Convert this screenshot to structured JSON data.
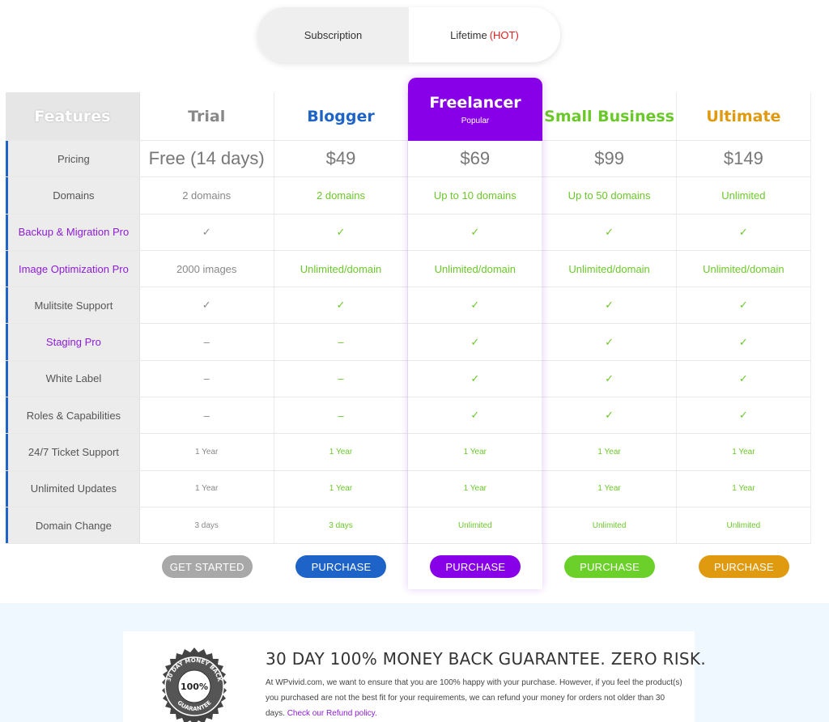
{
  "toggle": {
    "subscription_label": "Subscription",
    "lifetime_label": "Lifetime",
    "lifetime_hot": "(HOT)"
  },
  "table": {
    "features_header": "Features",
    "plans": [
      {
        "name": "Trial",
        "color": "#888888"
      },
      {
        "name": "Blogger",
        "color": "#1e64c8"
      },
      {
        "name": "Freelancer",
        "color": "#8800e8",
        "badge": "Popular"
      },
      {
        "name": "Small Business",
        "color": "#6bc82a"
      },
      {
        "name": "Ultimate",
        "color": "#e09a10"
      }
    ],
    "rows": [
      {
        "feature": "Pricing",
        "feature_color": "normal",
        "type": "price",
        "values": [
          "Free (14 days)",
          "$49",
          "$69",
          "$99",
          "$149"
        ]
      },
      {
        "feature": "Domains",
        "feature_color": "normal",
        "values": [
          "2 domains",
          "2 domains",
          "Up to 10 domains",
          "Up to 50 domains",
          "Unlimited"
        ]
      },
      {
        "feature": "Backup & Migration Pro",
        "feature_color": "purple",
        "values": [
          "✓",
          "✓",
          "✓",
          "✓",
          "✓"
        ]
      },
      {
        "feature": "Image Optimization Pro",
        "feature_color": "purple",
        "values": [
          "2000 images",
          "Unlimited/domain",
          "Unlimited/domain",
          "Unlimited/domain",
          "Unlimited/domain"
        ]
      },
      {
        "feature": "Mulitsite Support",
        "feature_color": "normal",
        "values": [
          "✓",
          "✓",
          "✓",
          "✓",
          "✓"
        ]
      },
      {
        "feature": "Staging Pro",
        "feature_color": "purple",
        "values": [
          "–",
          "–",
          "✓",
          "✓",
          "✓"
        ]
      },
      {
        "feature": "White Label",
        "feature_color": "normal",
        "values": [
          "–",
          "–",
          "✓",
          "✓",
          "✓"
        ]
      },
      {
        "feature": "Roles & Capabilities",
        "feature_color": "normal",
        "values": [
          "–",
          "–",
          "✓",
          "✓",
          "✓"
        ]
      },
      {
        "feature": "24/7 Ticket Support",
        "feature_color": "normal",
        "type": "small",
        "values": [
          "1 Year",
          "1 Year",
          "1 Year",
          "1 Year",
          "1 Year"
        ]
      },
      {
        "feature": "Unlimited Updates",
        "feature_color": "normal",
        "type": "small",
        "values": [
          "1 Year",
          "1 Year",
          "1 Year",
          "1 Year",
          "1 Year"
        ]
      },
      {
        "feature": "Domain Change",
        "feature_color": "normal",
        "type": "small",
        "values": [
          "3 days",
          "3 days",
          "Unlimited",
          "Unlimited",
          "Unlimited"
        ]
      }
    ],
    "buttons": [
      {
        "label": "GET STARTED",
        "color": "#a8a8a8"
      },
      {
        "label": "PURCHASE",
        "color": "#1e64c8"
      },
      {
        "label": "PURCHASE",
        "color": "#8800e8"
      },
      {
        "label": "PURCHASE",
        "color": "#6bd12a"
      },
      {
        "label": "PURCHASE",
        "color": "#e09a10"
      }
    ]
  },
  "guarantee": {
    "badge_top": "30 DAY MONEY BACK",
    "badge_center": "100%",
    "badge_bottom": "GUARANTEE",
    "title": "30 DAY 100% MONEY BACK GUARANTEE.  ZERO RISK.",
    "text": "At WPvivid.com, we want to ensure that you are 100% happy with your purchase. However, if you feel the product(s) you purchased are not the best fit for your requirements, we can refund your money for orders not older than 30 days.",
    "link": "Check our Refund policy."
  }
}
